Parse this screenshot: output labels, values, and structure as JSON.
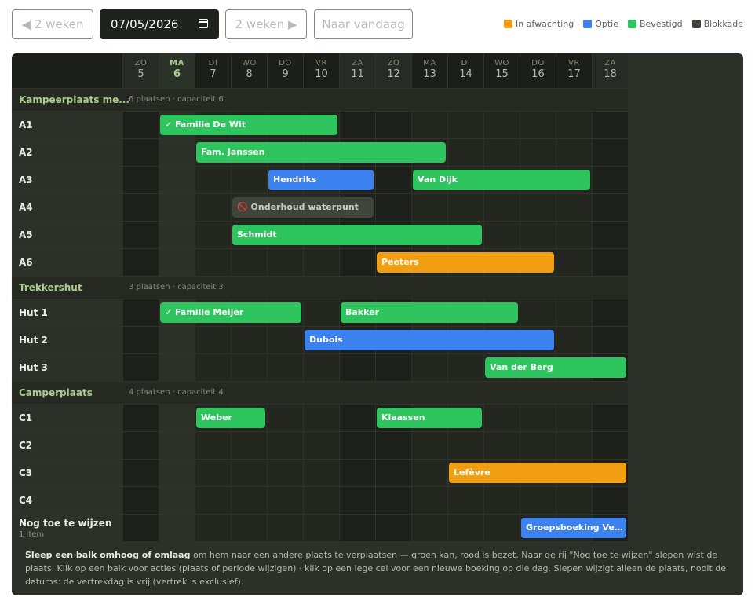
{
  "toolbar": {
    "prev_label": "◀ 2 weken",
    "date_value": "07/05/2026",
    "next_label": "2 weken ▶",
    "today_label": "Naar vandaag"
  },
  "legend": [
    {
      "label": "In afwachting",
      "color": "#f29e12"
    },
    {
      "label": "Optie",
      "color": "#3b82f0"
    },
    {
      "label": "Bevestigd",
      "color": "#2ec55f"
    },
    {
      "label": "Blokkade",
      "color": "#40453b"
    }
  ],
  "days": [
    {
      "dow": "ZO",
      "num": "5",
      "weekend": true
    },
    {
      "dow": "MA",
      "num": "6",
      "today": true
    },
    {
      "dow": "DI",
      "num": "7"
    },
    {
      "dow": "WO",
      "num": "8"
    },
    {
      "dow": "DO",
      "num": "9"
    },
    {
      "dow": "VR",
      "num": "10"
    },
    {
      "dow": "ZA",
      "num": "11",
      "weekend": true
    },
    {
      "dow": "ZO",
      "num": "12",
      "weekend": true
    },
    {
      "dow": "MA",
      "num": "13"
    },
    {
      "dow": "DI",
      "num": "14"
    },
    {
      "dow": "WO",
      "num": "15"
    },
    {
      "dow": "DO",
      "num": "16"
    },
    {
      "dow": "VR",
      "num": "17"
    },
    {
      "dow": "ZA",
      "num": "18",
      "weekend": true
    }
  ],
  "groups": [
    {
      "label": "Kampeerplaats me...",
      "sub": "6 plaatsen · capaciteit 6",
      "rows": [
        {
          "label": "A1",
          "bars": [
            {
              "text": "✓ Familie De Wit",
              "status": "bevestigd",
              "start_day": "6",
              "end_day": "11"
            }
          ]
        },
        {
          "label": "A2",
          "bars": [
            {
              "text": "Fam. Janssen",
              "status": "bevestigd",
              "start_day": "7",
              "end_day": "14"
            }
          ]
        },
        {
          "label": "A3",
          "bars": [
            {
              "text": "Hendriks",
              "status": "optie",
              "start_day": "9",
              "end_day": "12"
            },
            {
              "text": "Van Dijk",
              "status": "bevestigd",
              "start_day": "13",
              "end_day": "18"
            }
          ]
        },
        {
          "label": "A4",
          "bars": [
            {
              "text": "🚫 Onderhoud waterpunt",
              "status": "blokkade",
              "start_day": "8",
              "end_day": "12"
            }
          ]
        },
        {
          "label": "A5",
          "bars": [
            {
              "text": "Schmidt",
              "status": "bevestigd",
              "start_day": "8",
              "end_day": "15"
            }
          ]
        },
        {
          "label": "A6",
          "bars": [
            {
              "text": "Peeters",
              "status": "afwachting",
              "start_day": "12",
              "end_day": "17"
            }
          ]
        }
      ]
    },
    {
      "label": "Trekkershut",
      "sub": "3 plaatsen · capaciteit 3",
      "rows": [
        {
          "label": "Hut 1",
          "bars": [
            {
              "text": "✓ Familie Meijer",
              "status": "bevestigd",
              "start_day": "6",
              "end_day": "10"
            },
            {
              "text": "Bakker",
              "status": "bevestigd",
              "start_day": "11",
              "end_day": "16"
            }
          ]
        },
        {
          "label": "Hut 2",
          "bars": [
            {
              "text": "Dubois",
              "status": "optie",
              "start_day": "10",
              "end_day": "17"
            }
          ]
        },
        {
          "label": "Hut 3",
          "bars": [
            {
              "text": "Van der Berg",
              "status": "bevestigd",
              "start_day": "15",
              "end_day": "19"
            }
          ]
        }
      ]
    },
    {
      "label": "Camperplaats",
      "sub": "4 plaatsen · capaciteit 4",
      "rows": [
        {
          "label": "C1",
          "bars": [
            {
              "text": "Weber",
              "status": "bevestigd",
              "start_day": "7",
              "end_day": "9"
            },
            {
              "text": "Klaassen",
              "status": "bevestigd",
              "start_day": "12",
              "end_day": "15"
            }
          ]
        },
        {
          "label": "C2",
          "bars": []
        },
        {
          "label": "C3",
          "bars": [
            {
              "text": "Lefèvre",
              "status": "afwachting",
              "start_day": "14",
              "end_day": "19"
            }
          ]
        },
        {
          "label": "C4",
          "bars": []
        }
      ]
    }
  ],
  "unassigned": {
    "label": "Nog toe te wijzen",
    "sub": "1 item",
    "bars": [
      {
        "text": "Groepsboeking Verm...",
        "status": "optie",
        "start_day": "16",
        "end_day": "19"
      }
    ]
  },
  "footnote": {
    "bold": "Sleep een balk omhoog of omlaag",
    "rest": " om hem naar een andere plaats te verplaatsen — groen kan, rood is bezet. Naar de rij \"Nog toe te wijzen\" slepen wist de plaats. Klik op een balk voor acties (plaats of periode wijzigen) · klik op een lege cel voor een nieuwe boeking op die dag. Slepen wijzigt alleen de plaats, nooit de datums: de vertrekdag is vrij (vertrek is exclusief)."
  }
}
